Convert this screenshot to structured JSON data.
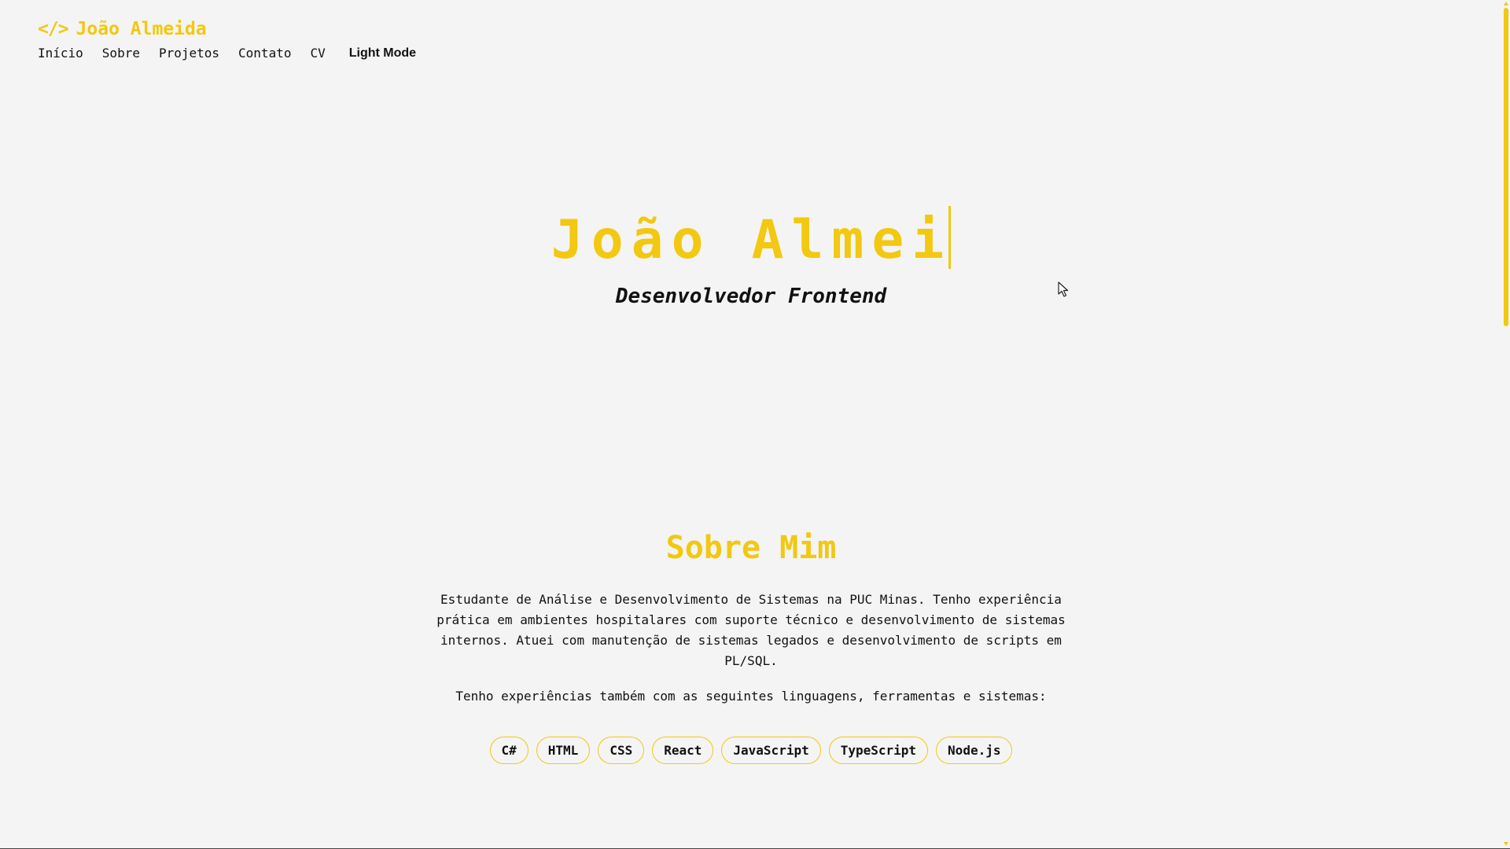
{
  "header": {
    "brand_icon": "</>",
    "brand_name": "João Almeida",
    "nav": {
      "inicio": "Início",
      "sobre": "Sobre",
      "projetos": "Projetos",
      "contato": "Contato",
      "cv": "CV"
    },
    "mode_toggle": "Light Mode"
  },
  "hero": {
    "title": "João Almei",
    "subtitle": "Desenvolvedor Frontend"
  },
  "about": {
    "title": "Sobre Mim",
    "paragraph1": "Estudante de Análise e Desenvolvimento de Sistemas na PUC Minas. Tenho experiência prática em ambientes hospitalares com suporte técnico e desenvolvimento de sistemas internos. Atuei com manutenção de sistemas legados e desenvolvimento de scripts em PL/SQL.",
    "paragraph2": "Tenho experiências também com as seguintes linguagens, ferramentas e sistemas:",
    "skills": [
      "C#",
      "HTML",
      "CSS",
      "React",
      "JavaScript",
      "TypeScript",
      "Node.js"
    ]
  },
  "colors": {
    "accent": "#f2c811",
    "background": "#f4f4f4",
    "text": "#111111"
  },
  "icons": {
    "brand": "code-icon",
    "cursor": "mouse-cursor-icon"
  }
}
